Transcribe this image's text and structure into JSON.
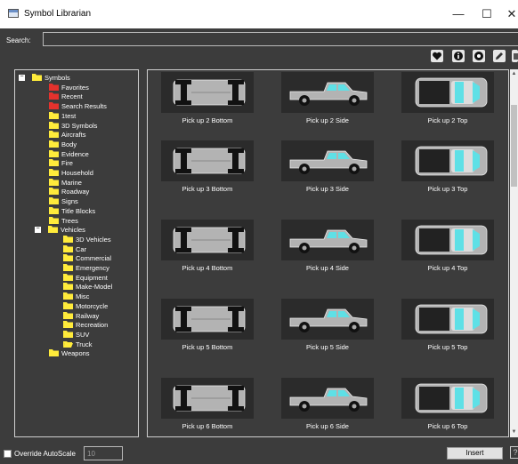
{
  "window": {
    "title": "Symbol Librarian",
    "minimize_glyph": "—",
    "maximize_glyph": "☐",
    "close_glyph": "✕"
  },
  "search": {
    "label": "Search:",
    "value": "",
    "placeholder": ""
  },
  "toolbar": {
    "buttons": [
      {
        "icon": "heart-icon"
      },
      {
        "icon": "info-icon"
      },
      {
        "icon": "settings-icon"
      },
      {
        "icon": "edit-icon"
      },
      {
        "icon": "delete-icon"
      }
    ]
  },
  "tree": {
    "items": [
      {
        "label": "Symbols",
        "expanded": true,
        "color": "#ffeb3b"
      },
      {
        "label": "Favorites",
        "color": "#e5322d"
      },
      {
        "label": "Recent",
        "color": "#e5322d"
      },
      {
        "label": "Search Results",
        "color": "#e5322d"
      },
      {
        "label": "1test",
        "color": "#ffeb3b"
      },
      {
        "label": "3D Symbols",
        "color": "#ffeb3b"
      },
      {
        "label": "Aircrafts",
        "color": "#ffeb3b"
      },
      {
        "label": "Body",
        "color": "#ffeb3b"
      },
      {
        "label": "Evidence",
        "color": "#ffeb3b"
      },
      {
        "label": "Fire",
        "color": "#ffeb3b"
      },
      {
        "label": "Household",
        "color": "#ffeb3b"
      },
      {
        "label": "Marine",
        "color": "#ffeb3b"
      },
      {
        "label": "Roadway",
        "color": "#ffeb3b"
      },
      {
        "label": "Signs",
        "color": "#ffeb3b"
      },
      {
        "label": "Title Blocks",
        "color": "#ffeb3b"
      },
      {
        "label": "Trees",
        "color": "#ffeb3b"
      },
      {
        "label": "Vehicles",
        "expanded": true,
        "color": "#ffeb3b"
      },
      {
        "label": "3D Vehicles",
        "color": "#ffeb3b"
      },
      {
        "label": "Car",
        "color": "#ffeb3b"
      },
      {
        "label": "Commercial",
        "color": "#ffeb3b"
      },
      {
        "label": "Emergency",
        "color": "#ffeb3b"
      },
      {
        "label": "Equipment",
        "color": "#ffeb3b"
      },
      {
        "label": "Make-Model",
        "color": "#ffeb3b"
      },
      {
        "label": "Misc",
        "color": "#ffeb3b"
      },
      {
        "label": "Motorcycle",
        "color": "#ffeb3b"
      },
      {
        "label": "Railway",
        "color": "#ffeb3b"
      },
      {
        "label": "Recreation",
        "color": "#ffeb3b"
      },
      {
        "label": "SUV",
        "color": "#ffeb3b"
      },
      {
        "label": "Truck",
        "open": true,
        "color": "#ffeb3b"
      },
      {
        "label": "Weapons",
        "color": "#ffeb3b"
      }
    ]
  },
  "symbols": [
    {
      "label": "Pick up 2 Bottom",
      "view": "bottom"
    },
    {
      "label": "Pick up 2 Side",
      "view": "side"
    },
    {
      "label": "Pick up 2 Top",
      "view": "top"
    },
    {
      "label": "Pick up 3 Bottom",
      "view": "bottom"
    },
    {
      "label": "Pick up 3 Side",
      "view": "side"
    },
    {
      "label": "Pick up 3 Top",
      "view": "top"
    },
    {
      "label": "Pick up 4 Bottom",
      "view": "bottom"
    },
    {
      "label": "Pick up 4 Side",
      "view": "side"
    },
    {
      "label": "Pick up 4 Top",
      "view": "top"
    },
    {
      "label": "Pick up 5 Bottom",
      "view": "bottom"
    },
    {
      "label": "Pick up 5 Side",
      "view": "side"
    },
    {
      "label": "Pick up 5 Top",
      "view": "top"
    },
    {
      "label": "Pick up 6 Bottom",
      "view": "bottom"
    },
    {
      "label": "Pick up 6 Side",
      "view": "side"
    },
    {
      "label": "Pick up 6 Top",
      "view": "top"
    }
  ],
  "footer": {
    "override_label": "Override AutoScale",
    "override_checked": false,
    "scale_value": "10",
    "insert_label": "Insert",
    "help_label": "?"
  },
  "colors": {
    "background": "#3c3c3c",
    "folder_yellow": "#ffeb3b",
    "folder_red": "#e5322d",
    "truck_body": "#b3b3b3",
    "window_glass": "#5ee0e6"
  }
}
